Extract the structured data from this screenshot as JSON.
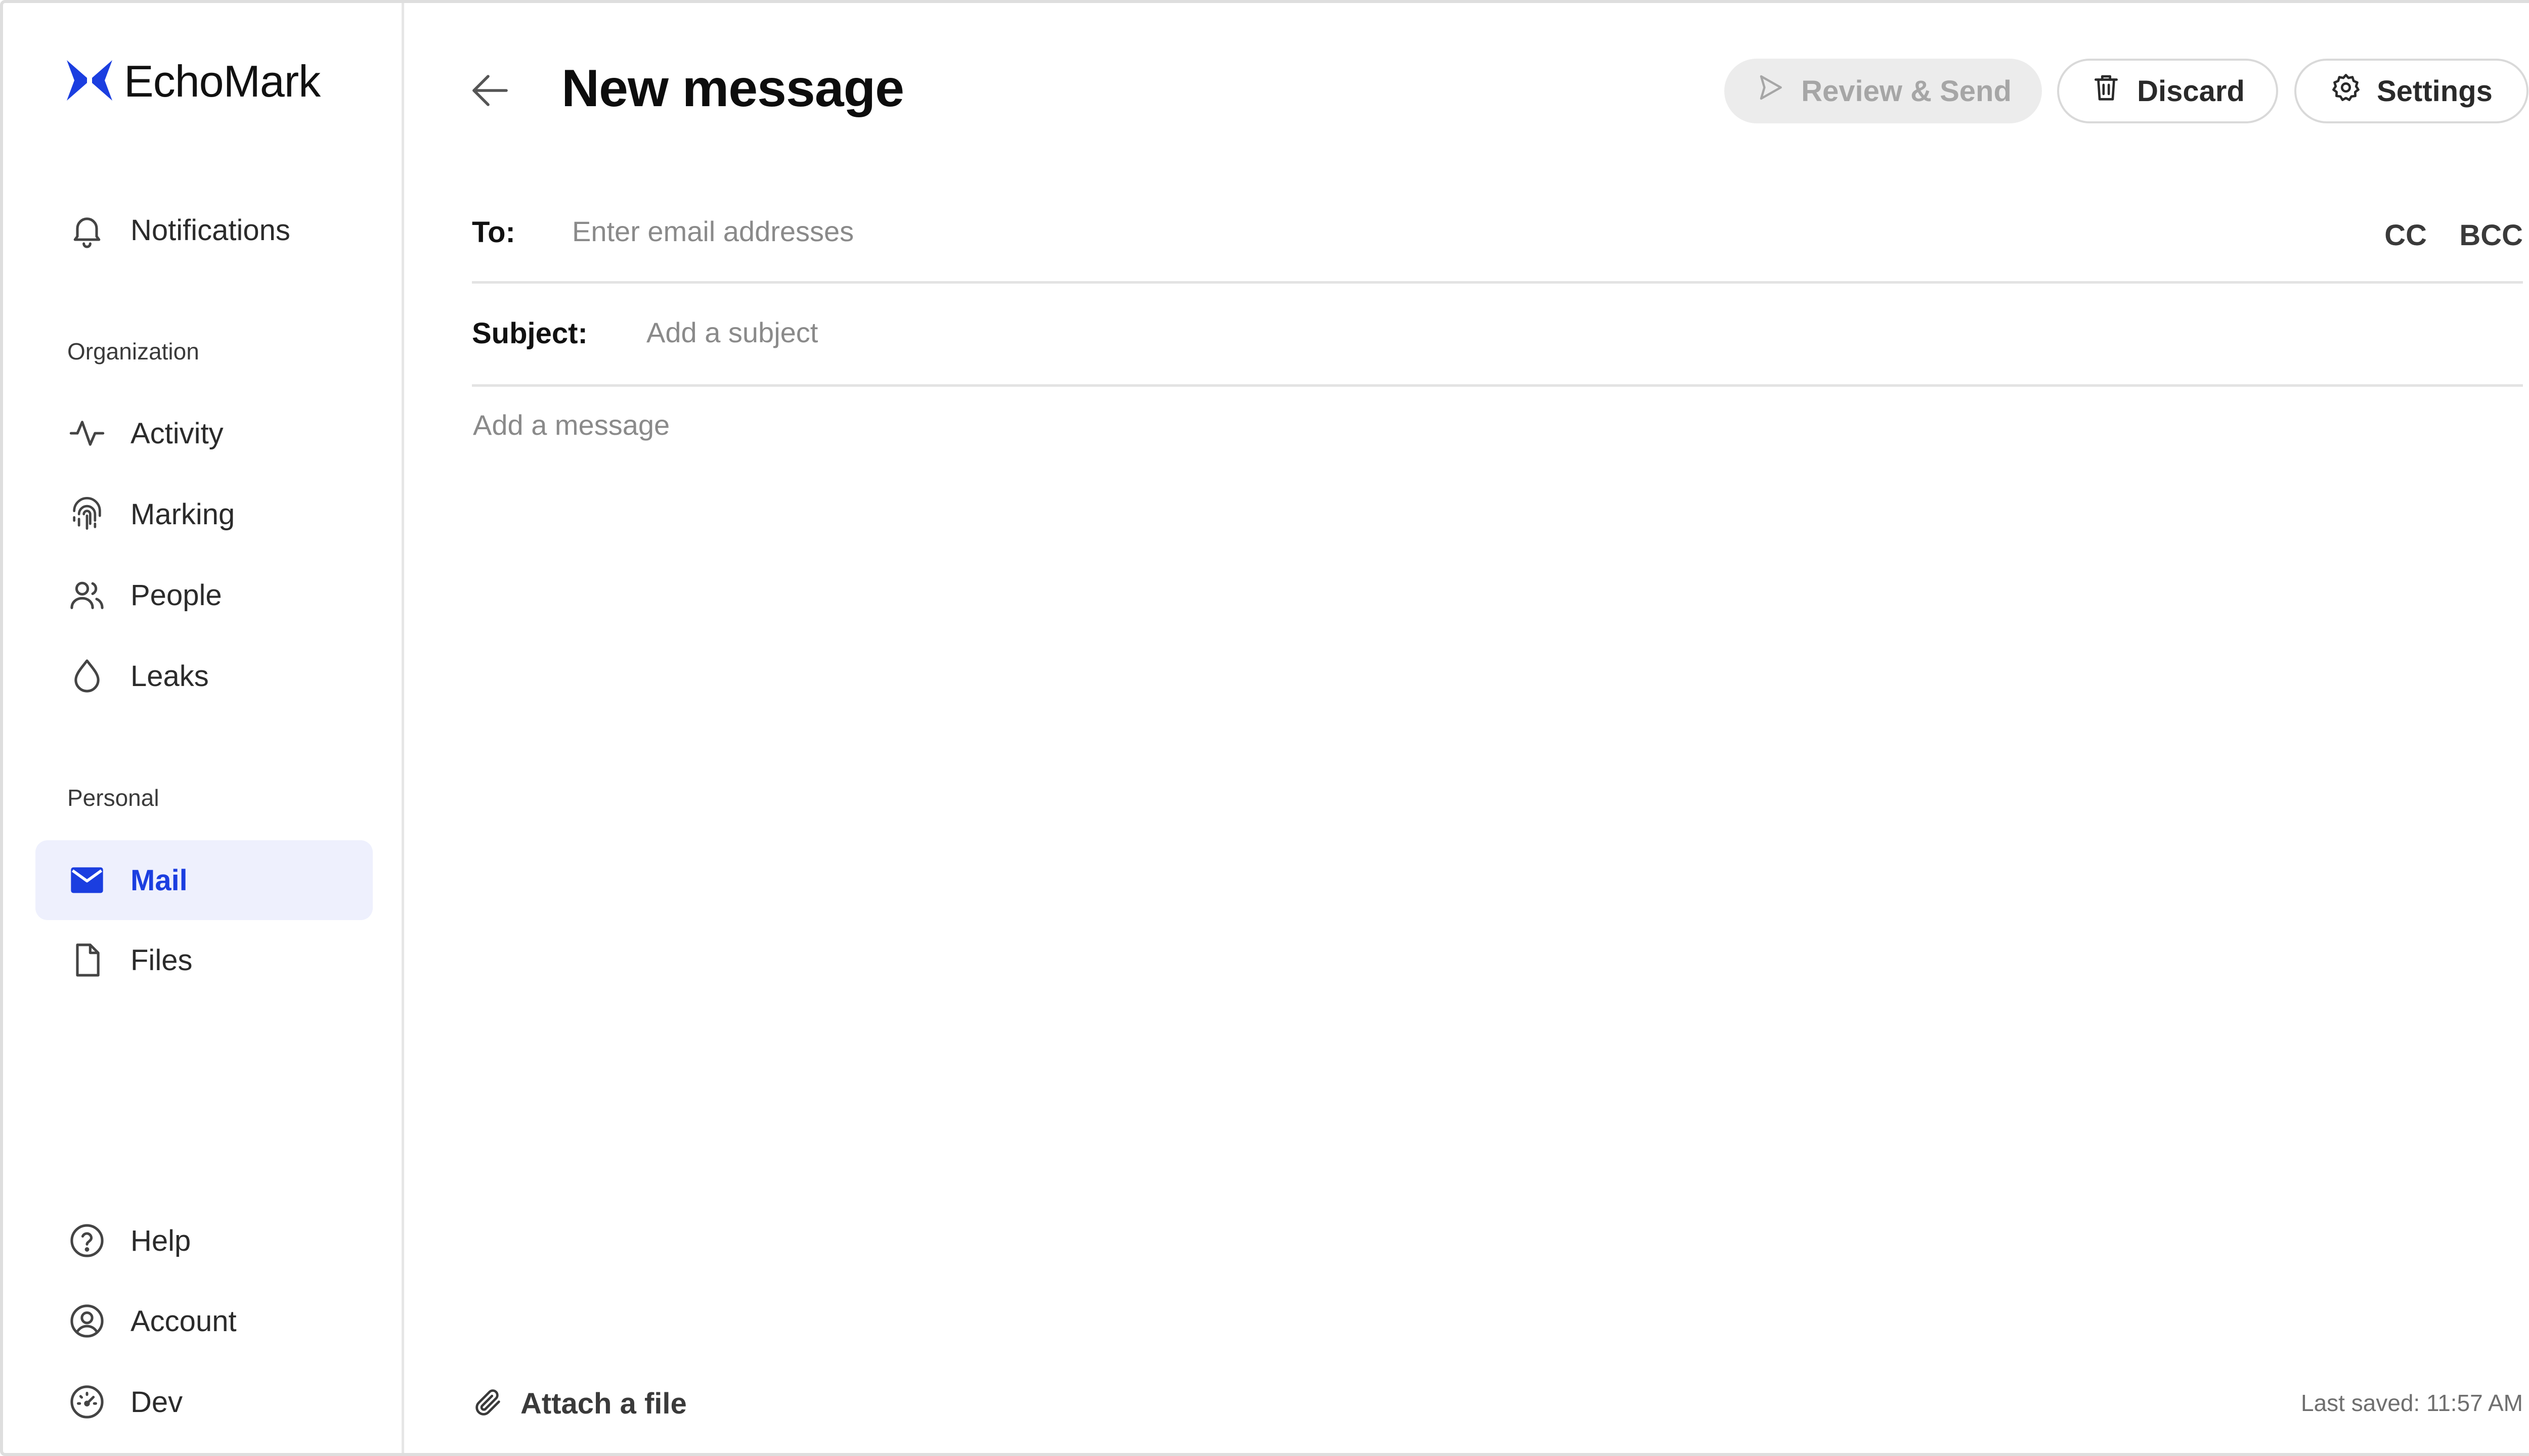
{
  "brand": {
    "name": "EchoMark",
    "accent": "#1b3ee0"
  },
  "sidebar": {
    "notifications": {
      "label": "Notifications",
      "icon": "bell-icon"
    },
    "sections": {
      "organization": "Organization",
      "personal": "Personal"
    },
    "organization_items": [
      {
        "label": "Activity",
        "icon": "activity-icon"
      },
      {
        "label": "Marking",
        "icon": "fingerprint-icon"
      },
      {
        "label": "People",
        "icon": "people-icon"
      },
      {
        "label": "Leaks",
        "icon": "droplet-icon"
      }
    ],
    "personal_items": [
      {
        "label": "Mail",
        "icon": "mail-icon",
        "active": true
      },
      {
        "label": "Files",
        "icon": "file-icon"
      }
    ],
    "footer_items": [
      {
        "label": "Help",
        "icon": "help-icon"
      },
      {
        "label": "Account",
        "icon": "account-icon"
      },
      {
        "label": "Dev",
        "icon": "gauge-icon"
      }
    ]
  },
  "header": {
    "title": "New message",
    "buttons": {
      "review": "Review & Send",
      "discard": "Discard",
      "settings": "Settings"
    }
  },
  "compose": {
    "to_label": "To:",
    "to_placeholder": "Enter email addresses",
    "to_value": "",
    "cc": "CC",
    "bcc": "BCC",
    "subject_label": "Subject:",
    "subject_placeholder": "Add a subject",
    "subject_value": "",
    "message_placeholder": "Add a message",
    "message_value": ""
  },
  "footer": {
    "attach_label": "Attach a file",
    "last_saved": "Last saved: 11:57 AM"
  }
}
